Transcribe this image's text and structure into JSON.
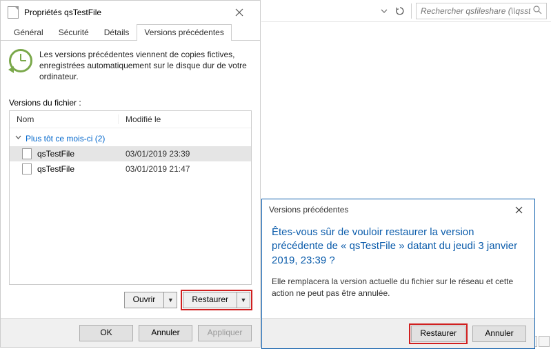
{
  "explorer": {
    "search_placeholder": "Rechercher qsfileshare (\\\\qsst..."
  },
  "props": {
    "title": "Propriétés qsTestFile",
    "tabs": {
      "general": "Général",
      "security": "Sécurité",
      "details": "Détails",
      "previous": "Versions précédentes"
    },
    "description": "Les versions précédentes viennent de copies fictives, enregistrées automatiquement sur le disque dur de votre ordinateur.",
    "versions_label": "Versions du fichier :",
    "columns": {
      "name": "Nom",
      "modified": "Modifié le"
    },
    "group_label": "Plus tôt ce mois-ci (2)",
    "files": [
      {
        "name": "qsTestFile",
        "date": "03/01/2019 23:39"
      },
      {
        "name": "qsTestFile",
        "date": "03/01/2019 21:47"
      }
    ],
    "open_label": "Ouvrir",
    "restore_label": "Restaurer",
    "ok": "OK",
    "cancel": "Annuler",
    "apply": "Appliquer"
  },
  "confirm": {
    "title": "Versions précédentes",
    "heading": "Êtes-vous sûr de vouloir restaurer la version précédente de « qsTestFile » datant du jeudi 3 janvier 2019, 23:39 ?",
    "body": "Elle remplacera la version actuelle du fichier sur le réseau et cette action ne peut pas être annulée.",
    "restore": "Restaurer",
    "cancel": "Annuler"
  }
}
